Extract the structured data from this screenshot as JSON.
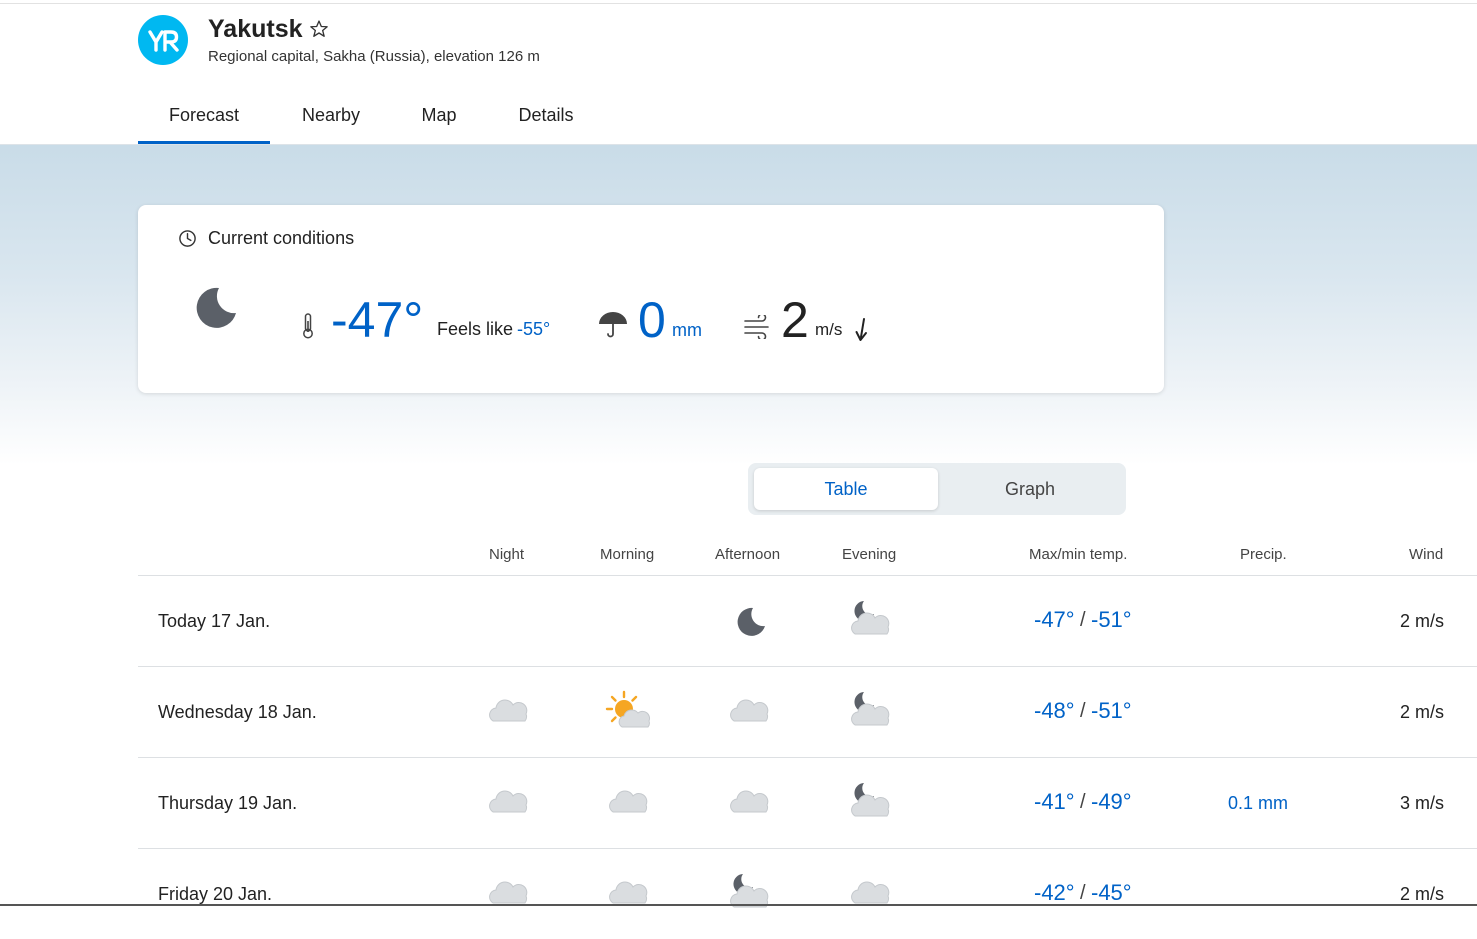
{
  "location": {
    "name": "Yakutsk",
    "description": "Regional capital, Sakha (Russia), elevation 126 m",
    "brand_color": "#00b8f1"
  },
  "tabs": [
    {
      "label": "Forecast",
      "active": true
    },
    {
      "label": "Nearby",
      "active": false
    },
    {
      "label": "Map",
      "active": false
    },
    {
      "label": "Details",
      "active": false
    }
  ],
  "current": {
    "title": "Current conditions",
    "icon": "moon-icon",
    "temperature": "-47°",
    "feels_like_label": "Feels like",
    "feels_like_value": "-55°",
    "precip_value": "0",
    "precip_unit": "mm",
    "wind_value": "2",
    "wind_unit": "m/s",
    "wind_direction_icon": "arrow-down-icon"
  },
  "view_toggle": {
    "options": [
      "Table",
      "Graph"
    ],
    "selected": "Table"
  },
  "table": {
    "headers": [
      "Night",
      "Morning",
      "Afternoon",
      "Evening",
      "Max/min temp.",
      "Precip.",
      "Wind"
    ],
    "rows": [
      {
        "day": "Today 17 Jan.",
        "icons": [
          "",
          "",
          "moon-icon",
          "moon-cloud-icon"
        ],
        "max": "-47°",
        "min": "-51°",
        "precip": "",
        "wind": "2 m/s"
      },
      {
        "day": "Wednesday 18 Jan.",
        "icons": [
          "cloud-icon",
          "sun-cloud-icon",
          "cloud-icon",
          "moon-cloud-icon"
        ],
        "max": "-48°",
        "min": "-51°",
        "precip": "",
        "wind": "2 m/s"
      },
      {
        "day": "Thursday 19 Jan.",
        "icons": [
          "cloud-icon",
          "cloud-icon",
          "cloud-icon",
          "moon-cloud-icon"
        ],
        "max": "-41°",
        "min": "-49°",
        "precip": "0.1 mm",
        "wind": "3 m/s"
      },
      {
        "day": "Friday 20 Jan.",
        "icons": [
          "cloud-icon",
          "cloud-icon",
          "moon-cloud-icon",
          "cloud-icon"
        ],
        "max": "-42°",
        "min": "-45°",
        "precip": "",
        "wind": "2 m/s"
      }
    ],
    "separator": "/"
  },
  "colors": {
    "accent": "#0062c7",
    "text": "#222222"
  }
}
